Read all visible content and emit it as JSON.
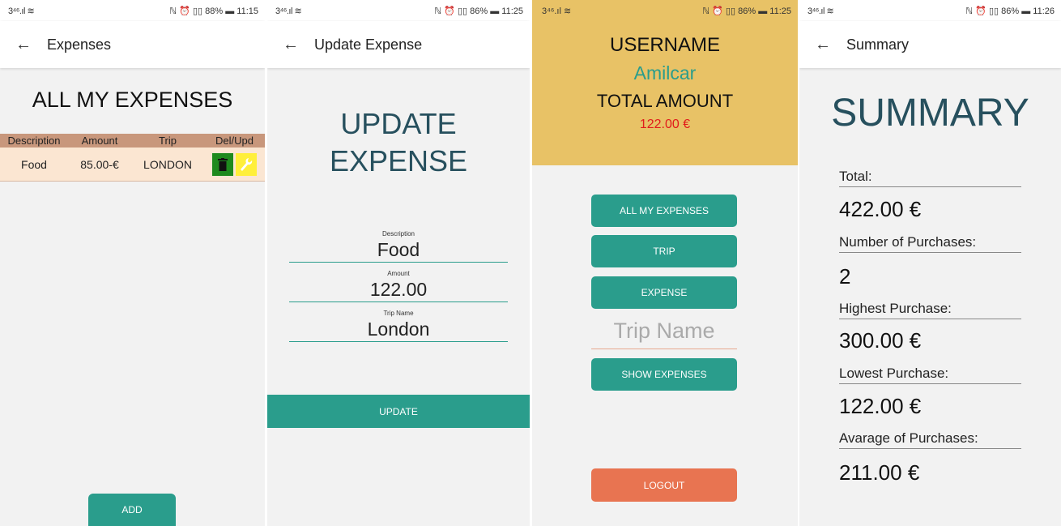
{
  "screens": [
    {
      "status": {
        "left": "3⁴⁶.ıl ≋",
        "right": "ℕ ⏰ ▯▯ 88% ▬ 11:15"
      },
      "appbar": {
        "back": "←",
        "title": "Expenses"
      },
      "heading": "ALL MY EXPENSES",
      "table": {
        "headers": [
          "Description",
          "Amount",
          "Trip",
          "Del/Upd"
        ],
        "rows": [
          {
            "description": "Food",
            "amount": "85.00-€",
            "trip": "LONDON"
          }
        ]
      },
      "add_label": "ADD"
    },
    {
      "status": {
        "left": "3⁴⁶.ıl ≋",
        "right": "ℕ ⏰ ▯▯ 86% ▬ 11:25"
      },
      "appbar": {
        "back": "←",
        "title": "Update Expense"
      },
      "heading_line1": "UPDATE",
      "heading_line2": "EXPENSE",
      "fields": [
        {
          "label": "Description",
          "value": "Food"
        },
        {
          "label": "Amount",
          "value": "122.00"
        },
        {
          "label": "Trip Name",
          "value": "London"
        }
      ],
      "update_label": "UPDATE"
    },
    {
      "status": {
        "left": "3⁴⁶.ıl ≋",
        "right": "ℕ ⏰ ▯▯ 86% ▬ 11:25"
      },
      "username_label": "USERNAME",
      "username": "Amilcar",
      "total_label": "TOTAL AMOUNT",
      "total_value": "122.00 €",
      "buttons": [
        "ALL MY EXPENSES",
        "TRIP",
        "EXPENSE"
      ],
      "trip_placeholder": "Trip Name",
      "show_label": "SHOW EXPENSES",
      "logout_label": "LOGOUT",
      "colors": {
        "header": "#e8c266",
        "username": "#2a9d8c",
        "total": "#e11b1b",
        "logout": "#e87451"
      }
    },
    {
      "status": {
        "left": "3⁴⁶.ıl ≋",
        "right": "ℕ ⏰ ▯▯ 86% ▬ 11:26"
      },
      "appbar": {
        "back": "←",
        "title": "Summary"
      },
      "heading": "SUMMARY",
      "items": [
        {
          "label": "Total:",
          "value": "422.00 €"
        },
        {
          "label": "Number of Purchases:",
          "value": "2"
        },
        {
          "label": "Highest Purchase:",
          "value": "300.00 €"
        },
        {
          "label": "Lowest Purchase:",
          "value": "122.00 €"
        },
        {
          "label": "Avarage of Purchases:",
          "value": "211.00 €"
        }
      ]
    }
  ],
  "colors": {
    "accent": "#2a9d8c",
    "heading": "#27505e",
    "table_header": "#c8977c",
    "table_row": "#fbe6d2",
    "delete": "#1e8a1e",
    "edit": "#ffef3a"
  }
}
